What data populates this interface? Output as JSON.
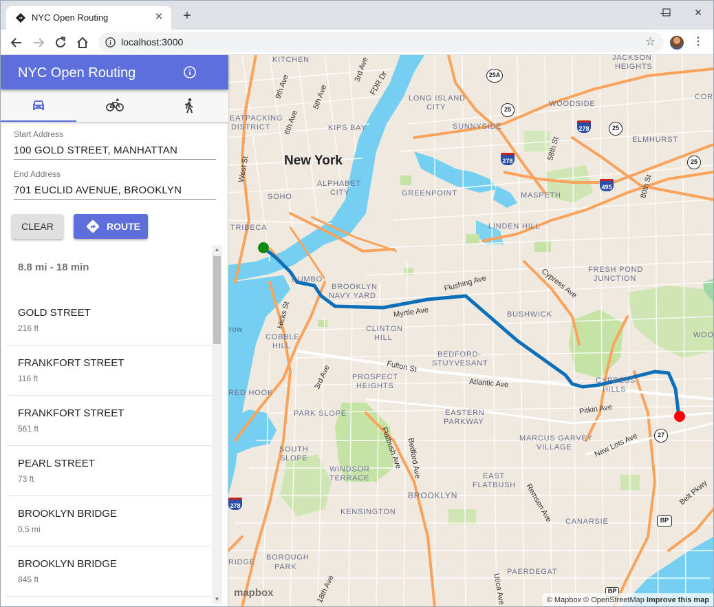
{
  "browser": {
    "tab_title": "NYC Open Routing",
    "close_symbol": "✕",
    "new_tab_symbol": "+",
    "url": "localhost:3000",
    "controls": {
      "minimize": "—",
      "maximize": "☐",
      "close": "✕"
    },
    "star_symbol": "☆",
    "menu_symbol": "⋮"
  },
  "app": {
    "title": "NYC Open Routing",
    "accent_color": "#5c6fdb",
    "modes": [
      {
        "icon": "car-icon",
        "active": true
      },
      {
        "icon": "bicycle-icon",
        "active": false
      },
      {
        "icon": "walking-icon",
        "active": false
      }
    ],
    "start": {
      "label": "Start Address",
      "value": "100 GOLD STREET, MANHATTAN"
    },
    "end": {
      "label": "End Address",
      "value": "701 EUCLID AVENUE, BROOKLYN"
    },
    "clear_label": "CLEAR",
    "route_label": "ROUTE",
    "summary": "8.8 mi - 18 min",
    "steps": [
      {
        "street": "GOLD STREET",
        "distance": "216 ft"
      },
      {
        "street": "FRANKFORT STREET",
        "distance": "116 ft"
      },
      {
        "street": "FRANKFORT STREET",
        "distance": "561 ft"
      },
      {
        "street": "PEARL STREET",
        "distance": "73 ft"
      },
      {
        "street": "BROOKLYN BRIDGE",
        "distance": "0.5 mi"
      },
      {
        "street": "BROOKLYN BRIDGE",
        "distance": "845 ft"
      }
    ]
  },
  "map": {
    "route_color": "#0d6fb8",
    "start_marker_color": "#118a11",
    "end_marker_color": "#ff0000",
    "water_color": "#75cff0",
    "park_color": "#c6e3a6",
    "highway_color": "#f9a35c",
    "labels": {
      "new_york": "New York",
      "kitchen": "KITCHEN",
      "jackson_heights_1": "JACKSON",
      "jackson_heights_2": "HEIGHTS",
      "long_island_1": "LONG ISLAND",
      "long_island_2": "CITY",
      "woodside": "WOODSIDE",
      "corona": "CORO",
      "meatpacking_1": "EATPACKING",
      "meatpacking_2": "DISTRICT",
      "kips_bay": "KIPS BAY",
      "sunnyside": "SUNNYSIDE",
      "elmhurst": "ELMHURST",
      "alphabet_1": "ALPHABET",
      "alphabet_2": "CITY",
      "greenpoint": "GREENPOINT",
      "maspeth": "MASPETH",
      "soho": "SOHO",
      "tribeca": "TRIBECA",
      "linden_hill": "LINDEN HILL",
      "fresh_pond_1": "FRESH POND",
      "fresh_pond_2": "JUNCTION",
      "dumbo": "DUMBO",
      "navy_yard_1": "BROOKLYN",
      "navy_yard_2": "NAVY YARD",
      "bushwick": "BUSHWICK",
      "clinton_1": "CLINTON",
      "clinton_2": "HILL",
      "cobble_1": "COBBLE",
      "cobble_2": "HILL",
      "bed_stuy_1": "BEDFORD-",
      "bed_stuy_2": "STUYVESANT",
      "woodhaven": "WOOD",
      "row": "row",
      "cypress_hills_1": "CYPRESS",
      "cypress_hills_2": "HILLS",
      "red_hook": "RED HOOK",
      "prospect_heights_1": "PROSPECT",
      "prospect_heights_2": "HEIGHTS",
      "park_slope": "PARK SLOPE",
      "eastern_parkway_1": "EASTERN",
      "eastern_parkway_2": "PARKWAY",
      "marcus_garvey_1": "MARCUS GARVEY",
      "marcus_garvey_2": "VILLAGE",
      "south_slope_1": "SOUTH",
      "south_slope_2": "SLOPE",
      "windsor_1": "WINDSOR",
      "windsor_2": "TERRACE",
      "east_flatbush_1": "EAST",
      "east_flatbush_2": "FLATBUSH",
      "brooklyn": "BROOKLYN",
      "kensington": "KENSINGTON",
      "canarsie": "CANARSIE",
      "borough_park_1": "BOROUGH",
      "borough_park_2": "PARK",
      "paerdegat": "PAERDEGAT",
      "bridge": "RIDGE"
    },
    "roads": {
      "ninth_ave": "9th Ave",
      "fifth_ave": "5th Ave",
      "third_ave": "3rd Ave",
      "fdr": "FDR Dr",
      "west_st": "West St",
      "sixth_ave": "6th Ave",
      "fiftyeighth": "58th St",
      "eightieth": "80th St",
      "flushing": "Flushing Ave",
      "cypress": "Cypress Ave",
      "myrtle": "Myrtle Ave",
      "hicks": "Hicks St",
      "fulton": "Fulton St",
      "third_ave_bk": "3rd Ave",
      "atlantic": "Atlantic Ave",
      "pitkin": "Pitkin Ave",
      "new_lots": "New Lots Ave",
      "flatbush": "Flatbush Ave",
      "bedford": "Bedford Ave",
      "remsen": "Remsen Ave",
      "belt": "Belt Pkwy",
      "eighteenth": "18th Ave",
      "utica": "Utica Ave"
    },
    "shields": {
      "r25a": "25A",
      "r25": "25",
      "r25b": "25",
      "r25c": "25",
      "i278a": "278",
      "i278b": "278",
      "i495": "495",
      "i278c": "278",
      "r27": "27",
      "bp": "BP",
      "bp2": "BP"
    },
    "logo": "mapbox",
    "attribution": "© Mapbox © OpenStreetMap",
    "improve": "Improve this map"
  }
}
